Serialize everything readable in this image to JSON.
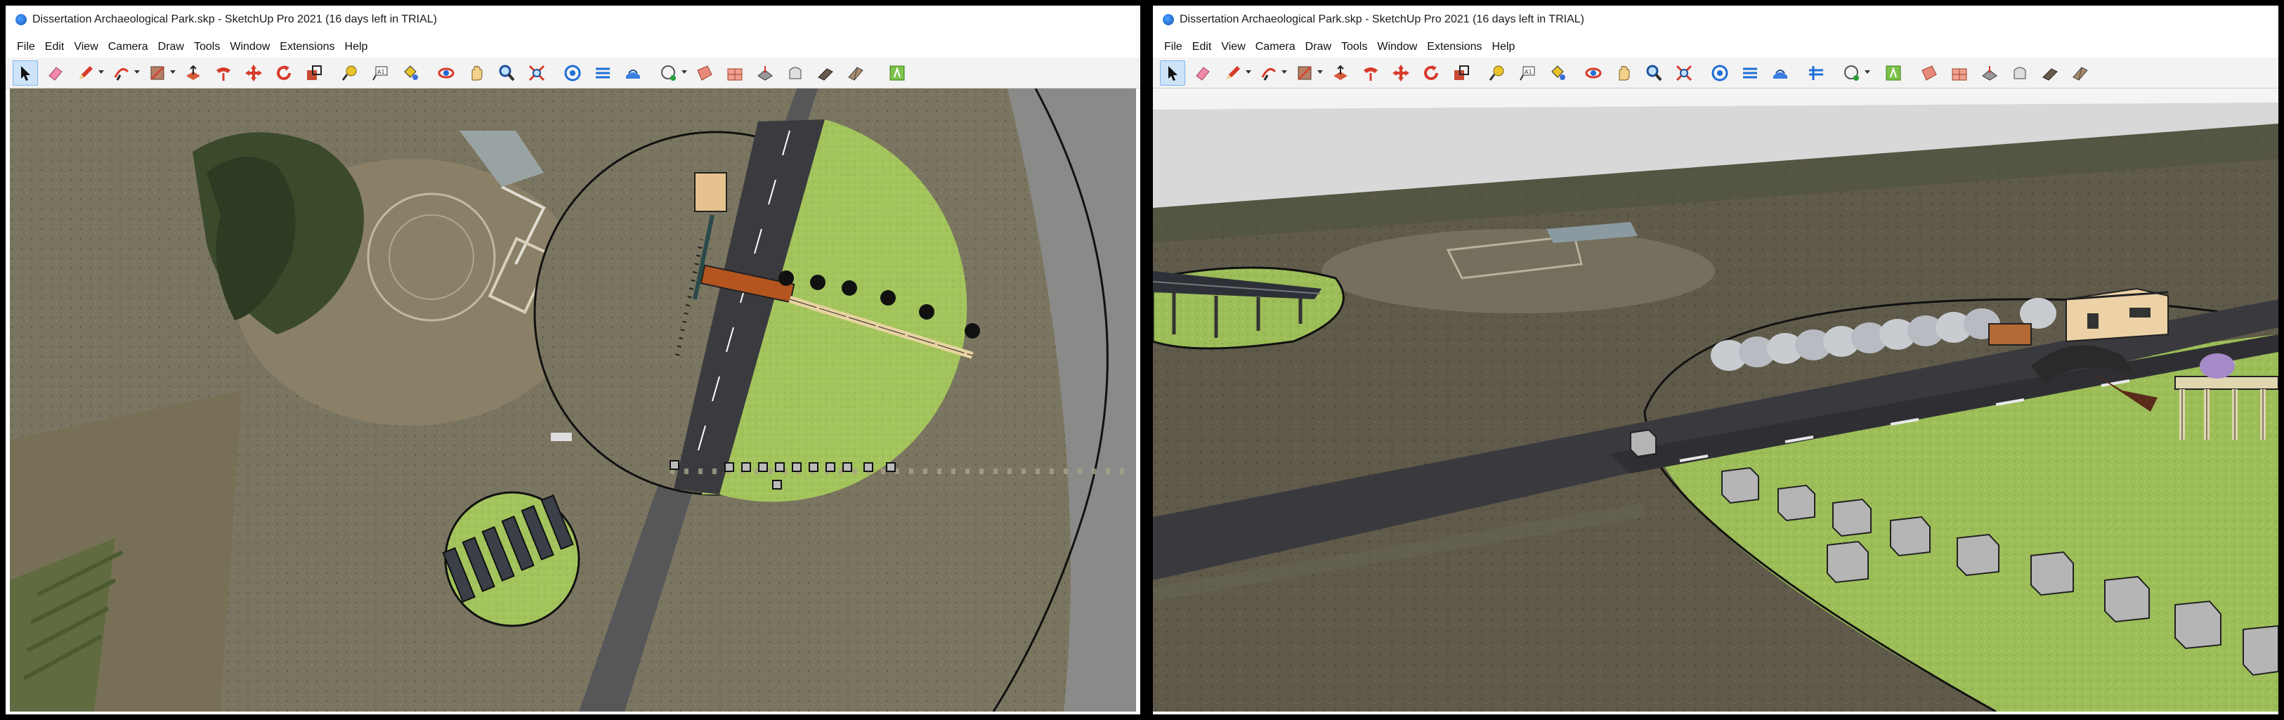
{
  "left_window": {
    "title": "Dissertation Archaeological Park.skp - SketchUp Pro 2021 (16 days left in TRIAL)",
    "menu": [
      "File",
      "Edit",
      "View",
      "Camera",
      "Draw",
      "Tools",
      "Window",
      "Extensions",
      "Help"
    ],
    "view": "top-down aerial plan"
  },
  "right_window": {
    "title": "Dissertation Archaeological Park.skp - SketchUp Pro 2021 (16 days left in TRIAL)",
    "menu": [
      "File",
      "Edit",
      "View",
      "Camera",
      "Draw",
      "Tools",
      "Window",
      "Extensions",
      "Help"
    ],
    "view": "perspective 3D"
  },
  "toolbar_icons": [
    "select-icon",
    "eraser-icon",
    "pencil-icon",
    "arc-icon",
    "shape-icon",
    "push-pull-icon",
    "follow-me-icon",
    "move-icon",
    "rotate-icon",
    "scale-icon",
    "tape-measure-icon",
    "text-icon",
    "paint-bucket-icon",
    "orbit-icon",
    "pan-icon",
    "zoom-icon",
    "zoom-extents-icon",
    "3d-warehouse-icon",
    "extension-warehouse-icon",
    "layout-icon",
    "styles-icon",
    "add-location-icon",
    "sandbox-icon"
  ],
  "colors": {
    "lawn": "#9fc25a",
    "road": "#3a3a3e",
    "accent_active": "#cde3f8",
    "terrain": "#7a735e"
  }
}
